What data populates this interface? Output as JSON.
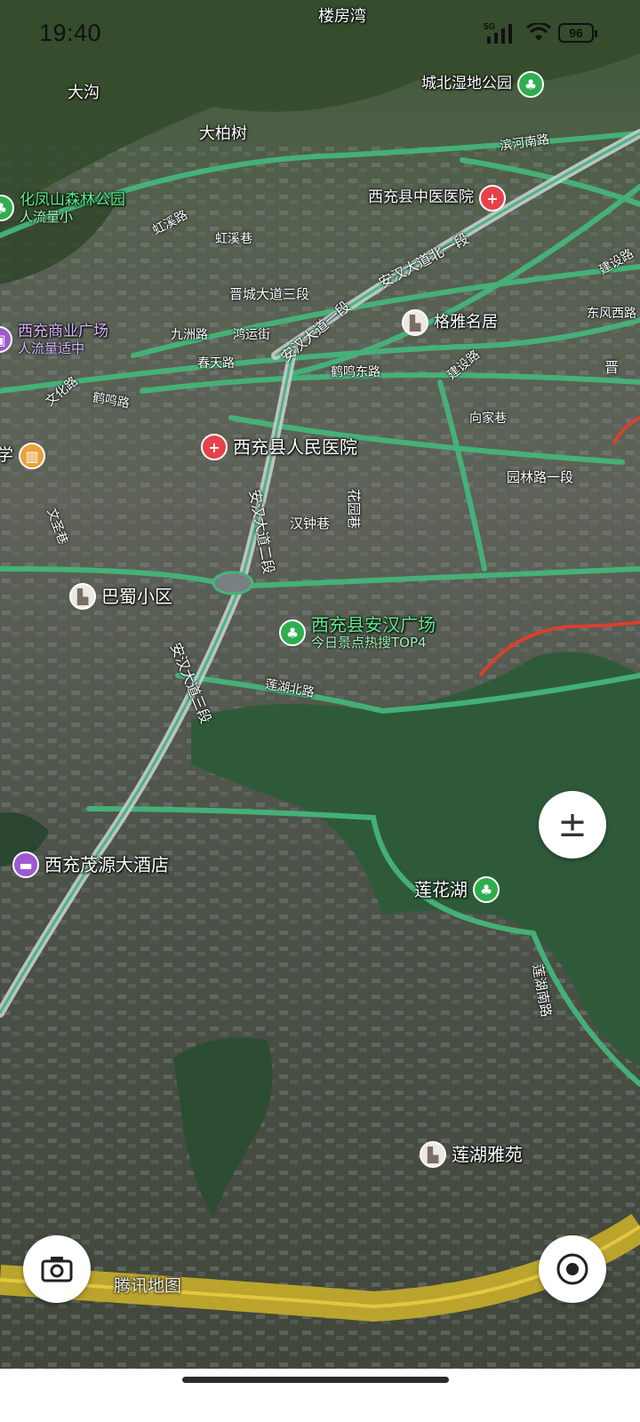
{
  "status_bar": {
    "time": "19:40",
    "network": "5G",
    "battery": "96"
  },
  "place_labels": {
    "loufangwan": "楼房湾",
    "dagou": "大沟",
    "dabaishu": "大柏树"
  },
  "roads": {
    "hongxi_lu": "虹溪路",
    "hongxi_xiang": "虹溪巷",
    "jincheng_3": "晋城大道三段",
    "anhan_1": "安汉大道一段",
    "anhan_north_1": "安汉大道北一段",
    "binhe_south": "滨河南路",
    "jiangshe": "建设路",
    "dongfeng_west": "东风西路",
    "jin": "晋",
    "jiuzhou": "九洲路",
    "hongyun": "鸿运街",
    "chuntian": "春天路",
    "heming_east": "鹤鸣东路",
    "jianshe2": "建设路",
    "xiangjia": "向家巷",
    "wenhua": "文化路",
    "heming": "鹤鸣路",
    "yuanlin_1": "园林路一段",
    "anhan_2": "安汉大道二段",
    "huayuan": "花园巷",
    "hanzhong": "汉钟巷",
    "wensheng": "文圣巷",
    "anhan_3": "安汉大道三段",
    "lianhu_north": "莲湖北路",
    "lianhu_south": "莲湖南路"
  },
  "pois": {
    "chengbei_park": "城北湿地公园",
    "huafengshan": {
      "name": "化凤山森林公园",
      "sub": "人流量小"
    },
    "zhongyi_hospital": "西充县中医医院",
    "geya": "格雅名居",
    "shangye": {
      "name": "西充商业广场",
      "sub": "人流量适中"
    },
    "school": "学",
    "renmin_hospital": "西充县人民医院",
    "bashu": "巴蜀小区",
    "anhan_square": {
      "name": "西充县安汉广场",
      "sub": "今日景点热搜TOP4"
    },
    "hotel": "西充茂源大酒店",
    "lianhua_lake": "莲花湖",
    "lianhu_yayuan": "莲湖雅苑"
  },
  "controls": {
    "zoom_symbol": "±",
    "camera": "camera-icon",
    "locate": "locate-icon"
  },
  "watermark": "腾讯地图",
  "colors": {
    "road_green": "#45b57a",
    "road_yellow": "#c8ae2a",
    "water": "#2f5a3a",
    "veg": "#34472e"
  }
}
